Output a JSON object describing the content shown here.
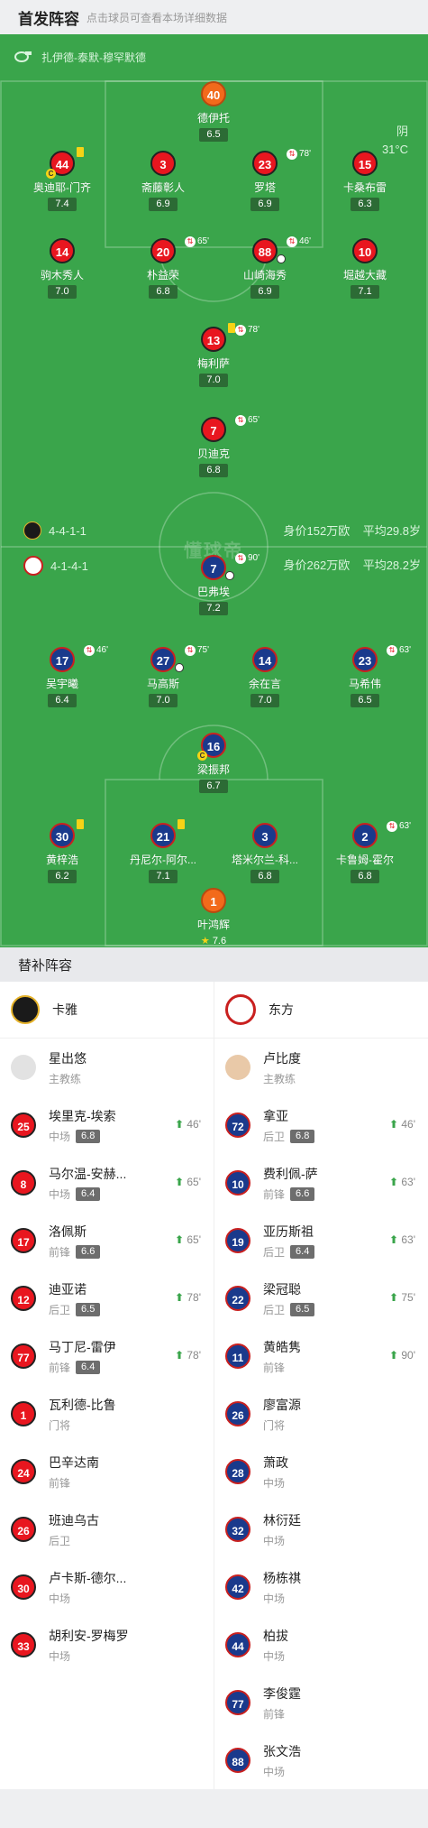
{
  "header": {
    "title": "首发阵容",
    "hint": "点击球员可查看本场详细数据"
  },
  "pitch": {
    "referee": "扎伊德-泰默-穆罕默德",
    "weather": "阴",
    "temperature": "31°C",
    "watermark": "懂球帝",
    "home_formation": "4-4-1-1",
    "home_value": "身价152万欧",
    "home_avg_age": "平均29.8岁",
    "away_formation": "4-1-4-1",
    "away_value": "身价262万欧",
    "away_avg_age": "平均28.2岁",
    "home_players": [
      {
        "num": "40",
        "name": "德伊托",
        "rating": "6.5",
        "gk": true
      },
      {
        "num": "44",
        "name": "奥迪耶-门齐",
        "rating": "7.4",
        "yellow": true,
        "captain": "C"
      },
      {
        "num": "3",
        "name": "斋藤彰人",
        "rating": "6.9"
      },
      {
        "num": "23",
        "name": "罗塔",
        "rating": "6.9",
        "sub": "78'"
      },
      {
        "num": "15",
        "name": "卡桑布雷",
        "rating": "6.3"
      },
      {
        "num": "14",
        "name": "驹木秀人",
        "rating": "7.0"
      },
      {
        "num": "20",
        "name": "朴益荣",
        "rating": "6.8",
        "sub": "65'"
      },
      {
        "num": "88",
        "name": "山崎海秀",
        "rating": "6.9",
        "sub": "46'",
        "ball": true
      },
      {
        "num": "10",
        "name": "堀越大藏",
        "rating": "7.1"
      },
      {
        "num": "13",
        "name": "梅利萨",
        "rating": "7.0",
        "yellow": true,
        "sub": "78'"
      },
      {
        "num": "7",
        "name": "贝迪克",
        "rating": "6.8",
        "sub": "65'"
      }
    ],
    "away_players": [
      {
        "num": "7",
        "name": "巴弗埃",
        "rating": "7.2",
        "sub": "90'",
        "ball": true
      },
      {
        "num": "17",
        "name": "吴宇曦",
        "rating": "6.4",
        "sub": "46'"
      },
      {
        "num": "27",
        "name": "马高斯",
        "rating": "7.0",
        "sub": "75'",
        "ball": true
      },
      {
        "num": "14",
        "name": "余在言",
        "rating": "7.0"
      },
      {
        "num": "23",
        "name": "马希伟",
        "rating": "6.5",
        "sub": "63'"
      },
      {
        "num": "16",
        "name": "梁振邦",
        "rating": "6.7",
        "captain": "C"
      },
      {
        "num": "30",
        "name": "黄梓浩",
        "rating": "6.2",
        "yellow": true
      },
      {
        "num": "21",
        "name": "丹尼尔-阿尔...",
        "rating": "7.1",
        "yellow": true
      },
      {
        "num": "3",
        "name": "塔米尔兰-科...",
        "rating": "6.8"
      },
      {
        "num": "2",
        "name": "卡鲁姆-霍尔",
        "rating": "6.8",
        "sub": "63'"
      },
      {
        "num": "1",
        "name": "叶鸿辉",
        "rating": "7.6",
        "gk": true,
        "star": true
      }
    ]
  },
  "subs": {
    "title": "替补阵容",
    "home": {
      "team": "卡雅",
      "coach": {
        "name": "星出悠",
        "role": "主教练"
      },
      "players": [
        {
          "num": "25",
          "name": "埃里克-埃索",
          "pos": "中场",
          "rating": "6.8",
          "on": "46'"
        },
        {
          "num": "8",
          "name": "马尔温-安赫...",
          "pos": "中场",
          "rating": "6.4",
          "on": "65'"
        },
        {
          "num": "17",
          "name": "洛佩斯",
          "pos": "前锋",
          "rating": "6.6",
          "on": "65'"
        },
        {
          "num": "12",
          "name": "迪亚诺",
          "pos": "后卫",
          "rating": "6.5",
          "on": "78'"
        },
        {
          "num": "77",
          "name": "马丁尼-雷伊",
          "pos": "前锋",
          "rating": "6.4",
          "on": "78'"
        },
        {
          "num": "1",
          "name": "瓦利德-比鲁",
          "pos": "门将"
        },
        {
          "num": "24",
          "name": "巴辛达南",
          "pos": "前锋"
        },
        {
          "num": "26",
          "name": "班迪乌古",
          "pos": "后卫"
        },
        {
          "num": "30",
          "name": "卢卡斯-德尔...",
          "pos": "中场"
        },
        {
          "num": "33",
          "name": "胡利安-罗梅罗",
          "pos": "中场"
        }
      ]
    },
    "away": {
      "team": "东方",
      "coach": {
        "name": "卢比度",
        "role": "主教练"
      },
      "players": [
        {
          "num": "72",
          "name": "拿亚",
          "pos": "后卫",
          "rating": "6.8",
          "on": "46'"
        },
        {
          "num": "10",
          "name": "费利佩-萨",
          "pos": "前锋",
          "rating": "6.6",
          "on": "63'"
        },
        {
          "num": "19",
          "name": "亚历斯祖",
          "pos": "后卫",
          "rating": "6.4",
          "on": "63'"
        },
        {
          "num": "22",
          "name": "梁冠聪",
          "pos": "后卫",
          "rating": "6.5",
          "on": "75'"
        },
        {
          "num": "11",
          "name": "黄皓隽",
          "pos": "前锋",
          "on": "90'"
        },
        {
          "num": "26",
          "name": "廖富源",
          "pos": "门将"
        },
        {
          "num": "28",
          "name": "萧政",
          "pos": "中场"
        },
        {
          "num": "32",
          "name": "林衍廷",
          "pos": "中场"
        },
        {
          "num": "42",
          "name": "杨栋祺",
          "pos": "中场"
        },
        {
          "num": "44",
          "name": "柏拔",
          "pos": "中场"
        },
        {
          "num": "77",
          "name": "李俊霆",
          "pos": "前锋"
        },
        {
          "num": "88",
          "name": "张文浩",
          "pos": "中场"
        }
      ]
    }
  }
}
